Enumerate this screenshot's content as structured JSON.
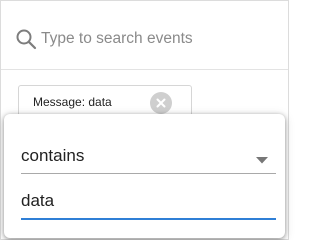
{
  "search": {
    "placeholder": "Type to search events",
    "value": "",
    "icon": "search-icon"
  },
  "filter_chip": {
    "label": "Message: data",
    "remove_icon": "close-circle-icon"
  },
  "filter_editor": {
    "operator": "contains",
    "operator_icon": "dropdown-arrow-icon",
    "value": "data",
    "accent_color": "#2f7fd6"
  }
}
